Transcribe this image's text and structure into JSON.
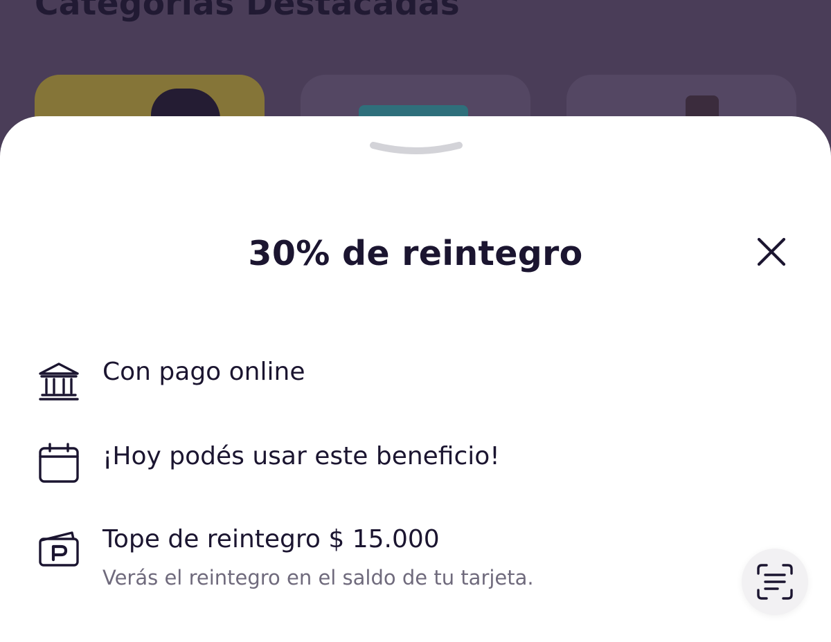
{
  "background": {
    "section_title": "Categorías Destacadas",
    "categories": [
      {
        "color": "#857538"
      },
      {
        "color": "#544763"
      },
      {
        "color": "#544763"
      }
    ]
  },
  "sheet": {
    "title": "30% de reintegro",
    "close_icon": "close-icon",
    "grabber_icon": "chevron-down-icon",
    "rows": [
      {
        "icon": "bank-icon",
        "text": "Con pago online"
      },
      {
        "icon": "calendar-icon",
        "text": "¡Hoy podés usar este beneficio!"
      },
      {
        "icon": "card-icon",
        "text": "Tope de reintegro $ 15.000",
        "subtext": "Verás el reintegro en el saldo de tu tarjeta."
      }
    ]
  },
  "floating_button": {
    "icon": "text-scan-icon"
  },
  "colors": {
    "text_primary": "#1b1530",
    "text_secondary": "#6f6a7c",
    "overlay": "#4a3d58",
    "sheet_bg": "#ffffff",
    "grabber": "#d3d3d8"
  }
}
